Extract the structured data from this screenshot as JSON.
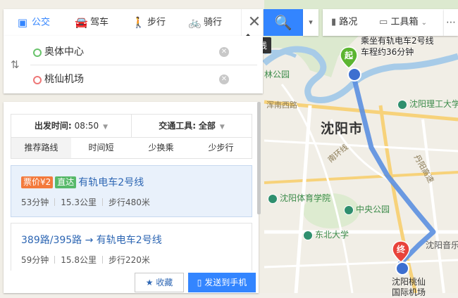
{
  "modes": [
    {
      "label": "公交",
      "icon": "bus-icon",
      "active": true
    },
    {
      "label": "驾车",
      "icon": "car-icon",
      "active": false
    },
    {
      "label": "步行",
      "icon": "walk-icon",
      "active": false
    },
    {
      "label": "骑行",
      "icon": "bike-icon",
      "active": false
    }
  ],
  "close_tooltip": "关闭路线",
  "tools": {
    "traffic": "路况",
    "toolbox": "工具箱"
  },
  "route": {
    "from": "奥体中心",
    "to": "桃仙机场"
  },
  "filters": {
    "depart_label": "出发时间:",
    "depart_time": "08:50",
    "vehicle_label": "交通工具:",
    "vehicle_value": "全部",
    "prefs": [
      "推荐路线",
      "时间短",
      "少换乘",
      "少步行"
    ]
  },
  "results": [
    {
      "price_tag": "票价¥2",
      "direct_tag": "直达",
      "title": "有轨电车2号线",
      "duration": "53分钟",
      "distance": "15.3公里",
      "walk": "步行480米"
    },
    {
      "title": "389路/395路 → 有轨电车2号线",
      "duration": "59分钟",
      "distance": "15.8公里",
      "walk": "步行220米"
    }
  ],
  "actions": {
    "favorite": "收藏",
    "send": "发送到手机"
  },
  "map": {
    "callout_line1": "乘坐有轨电车2号线",
    "callout_line2": "车程约36分钟",
    "start_marker": "起",
    "end_marker": "终",
    "labels": {
      "city": "沈阳市",
      "park1": "林公园",
      "road1": "浑南西路",
      "univ1": "沈阳理工大学",
      "road2": "南环线",
      "road3": "丹阳高速",
      "stadium": "沈阳体育学院",
      "park2": "中央公园",
      "univ2": "东北大学",
      "music": "沈阳音乐",
      "airport1": "沈阳桃仙",
      "airport2": "国际机场"
    }
  },
  "colors": {
    "accent": "#3385ff",
    "route_line": "#5b8fe0",
    "start_green": "#5cb531",
    "end_red": "#e8433b"
  }
}
